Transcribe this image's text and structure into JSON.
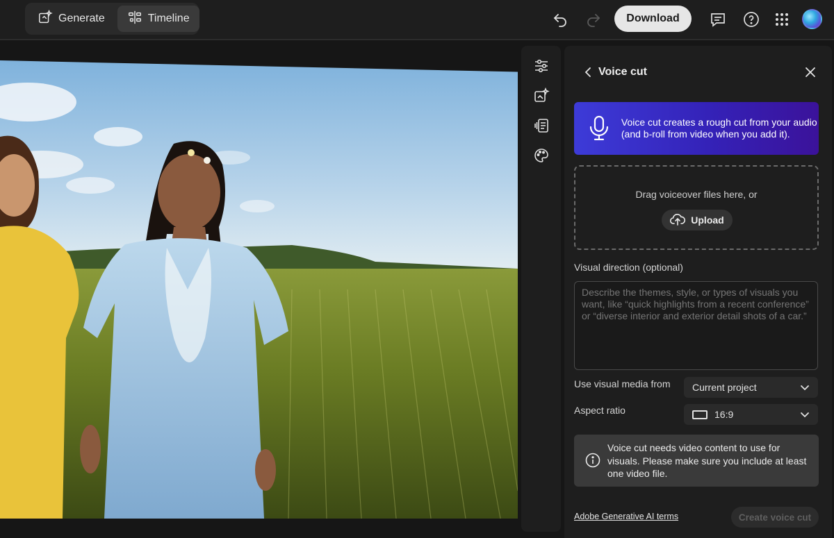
{
  "header": {
    "tabs": [
      {
        "label": "Generate",
        "icon": "generate-icon",
        "active": false
      },
      {
        "label": "Timeline",
        "icon": "timeline-icon",
        "active": true
      }
    ],
    "download_label": "Download",
    "icons": [
      "undo-icon",
      "redo-icon",
      "comment-icon",
      "help-icon",
      "apps-grid-icon",
      "avatar"
    ]
  },
  "rail": {
    "icons": [
      "adjustments-icon",
      "generate-media-icon",
      "transcript-icon",
      "color-palette-icon"
    ]
  },
  "panel": {
    "title": "Voice cut",
    "banner_text": "Voice cut creates a rough cut from your audio (and b-roll from video when you add it).",
    "dropzone_text": "Drag voiceover files here, or",
    "upload_label": "Upload",
    "visual_direction_label": "Visual direction (optional)",
    "visual_direction_placeholder": "Describe the themes, style, or types of visuals you want, like “quick highlights from a recent conference” or “diverse interior and exterior detail shots of a car.”",
    "media_label": "Use visual media from",
    "media_value": "Current project",
    "aspect_label": "Aspect ratio",
    "aspect_value": "16:9",
    "notice_text": "Voice cut needs video content to use for visuals. Please make sure you include at least one video file.",
    "terms_label": "Adobe Generative AI terms",
    "create_label": "Create voice cut"
  },
  "colors": {
    "banner_start": "#3d3bd8",
    "banner_end": "#3b129a",
    "download_bg": "#e6e6e6"
  }
}
